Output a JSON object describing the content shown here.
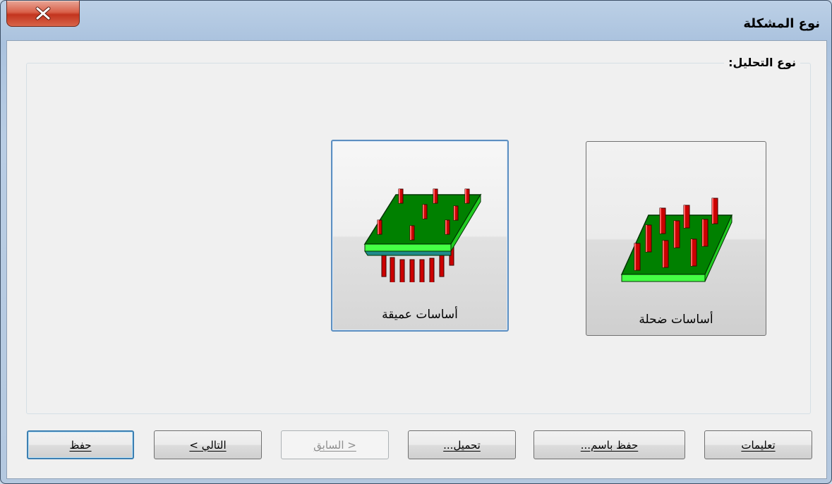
{
  "window": {
    "title": "نوع المشكلة",
    "close_glyph": "X"
  },
  "group": {
    "label": "نوع التحليل:"
  },
  "options": [
    {
      "label": "أساسات عميقة",
      "icon": "deep-foundation-icon",
      "focused": true
    },
    {
      "label": "أساسات ضحلة",
      "icon": "shallow-foundation-icon",
      "focused": false
    }
  ],
  "buttons": {
    "save": "حفظ",
    "next": "التالي >",
    "previous": "< السابق",
    "load": "تحميل...",
    "save_as": "حفظ باسم...",
    "help": "تعليمات"
  },
  "colors": {
    "slab_green": "#008000",
    "slab_edge": "#33ff33",
    "pile_red": "#cc0000",
    "focus_blue": "#3c7fb1",
    "close_red": "#c3341e"
  }
}
